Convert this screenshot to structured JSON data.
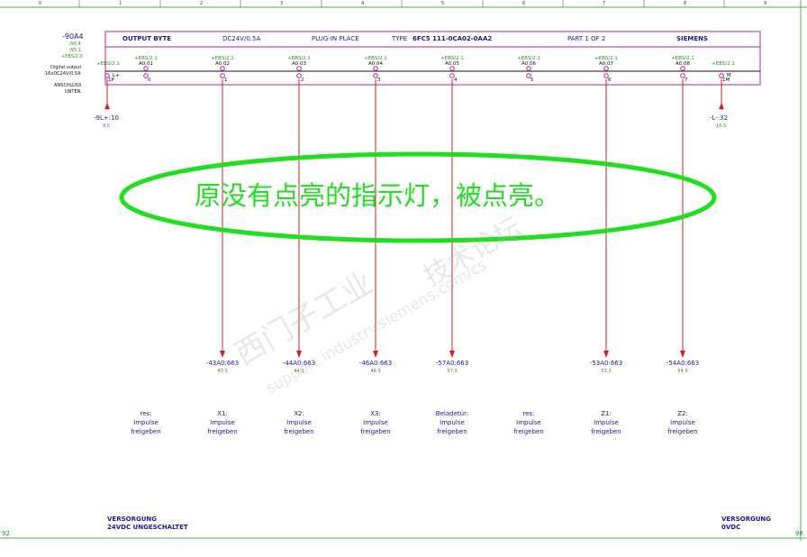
{
  "ruler": [
    "0",
    "1",
    "2",
    "3",
    "4",
    "5",
    "6",
    "7",
    "8",
    "9"
  ],
  "cabinet": {
    "ref": "-90A4",
    "sub": [
      "/90.4",
      "/95.1",
      "+EBS/2.0"
    ]
  },
  "left_labels": {
    "digital": [
      "Digital output",
      "16xDC24V/0,5A"
    ],
    "anschluss": [
      "ANSCHLUSS",
      "UNTEN"
    ]
  },
  "header": {
    "output_byte": "OUTPUT BYTE",
    "voltage": "DC24V/0.5A",
    "plug_in": "PLUG-IN PLACE",
    "type_label": "TYPE",
    "type_value": "6FC5 111-0CA02-0AA2",
    "part": "PART 1 OF 2",
    "maker": "SIEMENS"
  },
  "channels": [
    {
      "ebs": "+EBS/2.1",
      "addr": "A0.01",
      "pin": "0",
      "desc": [
        "res:",
        "Impulse",
        "freigeben"
      ]
    },
    {
      "ebs": "+EBS/2.1",
      "addr": "A0.02",
      "pin": "1",
      "sig": "-43A0:663",
      "sig_sub": "43.3",
      "desc": [
        "X1:",
        "Impulse",
        "freigeben"
      ]
    },
    {
      "ebs": "+EBS/2.1",
      "addr": "A0.03",
      "pin": "2",
      "sig": "-44A0:663",
      "sig_sub": "44.3",
      "desc": [
        "X2:",
        "Impulse",
        "freigeben"
      ]
    },
    {
      "ebs": "+EBS/2.1",
      "addr": "A0.04",
      "pin": "3",
      "sig": "-46A0:663",
      "sig_sub": "46.3",
      "desc": [
        "X3:",
        "Impulse",
        "freigeben"
      ]
    },
    {
      "ebs": "+EBS/2.1",
      "addr": "A0.05",
      "pin": "4",
      "sig": "-57A0:663",
      "sig_sub": "57.3",
      "desc": [
        "Beladetür:",
        "Impulse",
        "freigeben"
      ]
    },
    {
      "ebs": "+EBS/2.1",
      "addr": "A0.06",
      "pin": "5",
      "desc": [
        "res:",
        "Impulse",
        "freigeben"
      ]
    },
    {
      "ebs": "+EBS/2.1",
      "addr": "A0.07",
      "pin": "6",
      "sig": "-53A0:663",
      "sig_sub": "53.3",
      "desc": [
        "Z1:",
        "Impulse",
        "freigeben"
      ]
    },
    {
      "ebs": "+EBS/2.1",
      "addr": "A0.08",
      "pin": "7",
      "sig": "-54A0:663",
      "sig_sub": "54.3",
      "desc": [
        "Z2:",
        "Impulse",
        "freigeben"
      ]
    }
  ],
  "terminals": {
    "left": {
      "ebs": "+EBS/2.1",
      "pin": "1P",
      "mark": "L+",
      "ref": "-9L+:10",
      "sub": "9.0"
    },
    "right": {
      "ebs": "+EBS/2.1",
      "pin": "1M",
      "mark": "M",
      "ref": "-L-:32",
      "sub": "10.5"
    }
  },
  "annotation": "原没有点亮的指示灯，被点亮。",
  "watermark": {
    "text1": "西门子工业",
    "text2": "技术论坛",
    "url": "support.industry.siemens.com/cs"
  },
  "supply_left": [
    "VERSORGUNG",
    "24VDC UNGESCHALTET"
  ],
  "supply_right": [
    "VERSORGUNG",
    "0VDC"
  ],
  "page_left": "92",
  "page_right": "96",
  "colors": {
    "box": "#bb2299",
    "wire": "#cc2222",
    "text": "#1a1a9a",
    "green": "#2d8a2d",
    "annot": "#22dd22",
    "frame": "#55aa55"
  }
}
